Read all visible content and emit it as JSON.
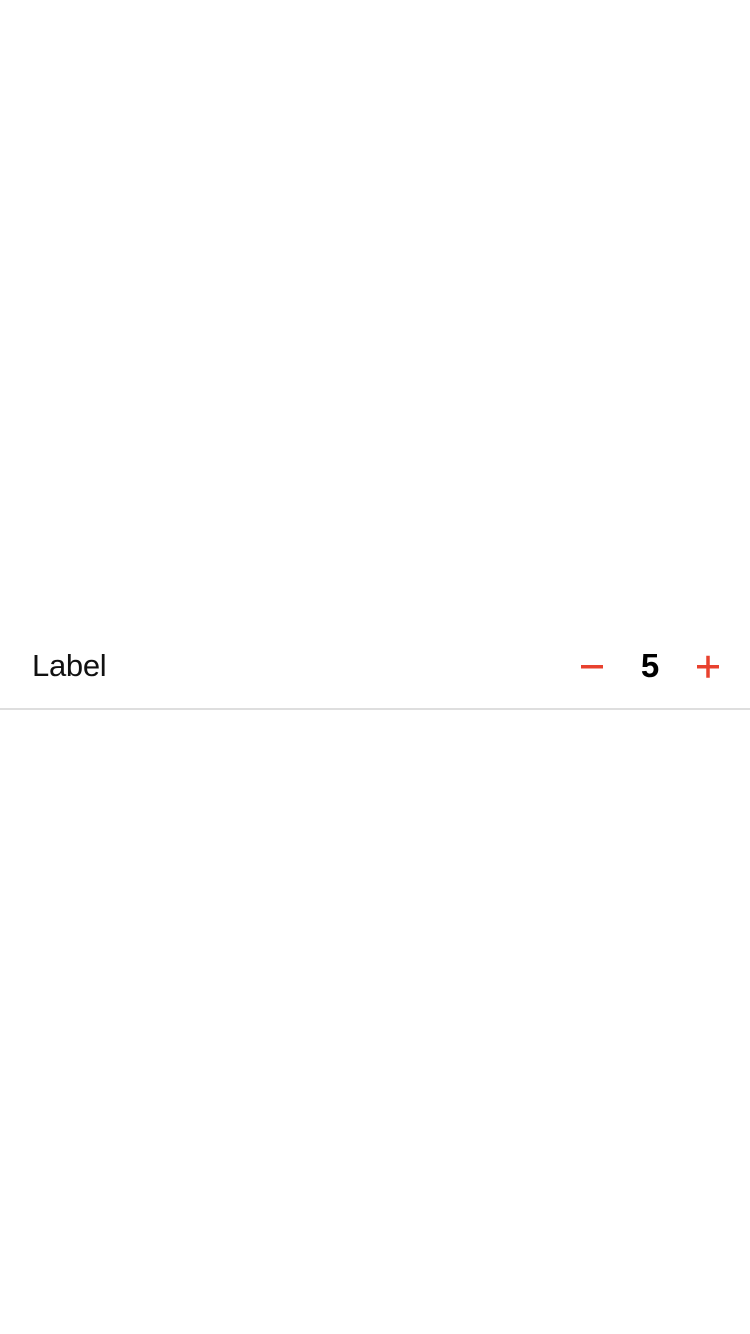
{
  "row": {
    "label": "Label",
    "value": "5"
  },
  "stepper": {
    "decrement_icon": "minus-icon",
    "increment_icon": "plus-icon",
    "accent_color": "#e8412e"
  },
  "divider_color": "#dedede"
}
